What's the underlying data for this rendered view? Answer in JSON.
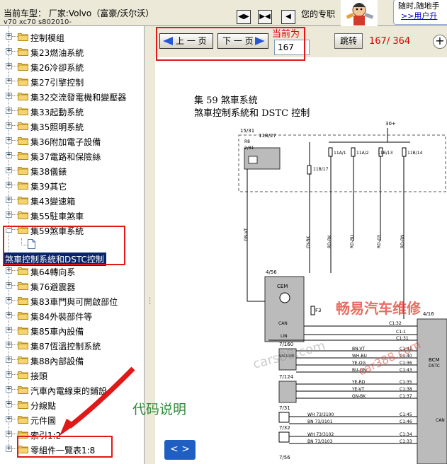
{
  "header": {
    "model_line1": "当前车型：  厂家:Volvo（富豪/沃尔沃）",
    "model_line2": "v70  xc70  s802010-",
    "nav_buttons": [
      "◀▶",
      "▶◀",
      "◀"
    ],
    "pro_text": "您的专职",
    "ad_line1": "随时,随地手",
    "ad_line2": ">>用户升"
  },
  "tree": {
    "items": [
      {
        "label": "控制模组",
        "state": "collapsed"
      },
      {
        "label": "集23燃油系統",
        "state": "collapsed"
      },
      {
        "label": "集26冷卻系統",
        "state": "collapsed"
      },
      {
        "label": "集27引擎控制",
        "state": "collapsed"
      },
      {
        "label": "集32交流發電機和變壓器",
        "state": "collapsed"
      },
      {
        "label": "集33起動系統",
        "state": "collapsed"
      },
      {
        "label": "集35照明系統",
        "state": "collapsed"
      },
      {
        "label": "集36附加電子設備",
        "state": "collapsed"
      },
      {
        "label": "集37電路和保險絲",
        "state": "collapsed"
      },
      {
        "label": "集38儀錶",
        "state": "collapsed"
      },
      {
        "label": "集39其它",
        "state": "collapsed"
      },
      {
        "label": "集43變速箱",
        "state": "collapsed"
      },
      {
        "label": "集55駐車煞車",
        "state": "collapsed"
      },
      {
        "label": "集59煞車系統",
        "state": "expanded"
      },
      {
        "label": "集64轉向系",
        "state": "collapsed"
      },
      {
        "label": "集76避震器",
        "state": "collapsed"
      },
      {
        "label": "集83車門與可開啟部位",
        "state": "collapsed"
      },
      {
        "label": "集84外裝部件等",
        "state": "collapsed"
      },
      {
        "label": "集85車內設備",
        "state": "collapsed"
      },
      {
        "label": "集87恆溫控制系統",
        "state": "collapsed"
      },
      {
        "label": "集88內部設備",
        "state": "collapsed"
      },
      {
        "label": "接頭",
        "state": "collapsed"
      },
      {
        "label": "汽車內電線束的鋪設",
        "state": "collapsed"
      },
      {
        "label": "分線點",
        "state": "collapsed"
      },
      {
        "label": "元件圖",
        "state": "collapsed"
      },
      {
        "label": "索引1:2",
        "state": "collapsed"
      },
      {
        "label": "零組件一覽表1:8",
        "state": "collapsed"
      }
    ],
    "selected_child": "煞車控制系統和DSTC控制"
  },
  "toolbar": {
    "prev_label": "上 一 页",
    "next_label": "下 一 页",
    "current_label": "当前为",
    "current_value": "167",
    "jump_label": "跳转",
    "page_count": "167/ 364",
    "zoom_label": "+"
  },
  "document": {
    "title1": "集 59 煞車系統",
    "title2": "煞車控制系統和 DSTC 控制",
    "pager_label": "< >",
    "watermark": "畅易汽车维修",
    "watermark2": "cars88.com",
    "watermark3": "car388.com"
  },
  "annotation": {
    "text": "代码说明"
  },
  "colors": {
    "highlight": "#e01818",
    "selection": "#0a246a",
    "annotation": "#2e8b3a",
    "accent": "#1f5fc2"
  }
}
